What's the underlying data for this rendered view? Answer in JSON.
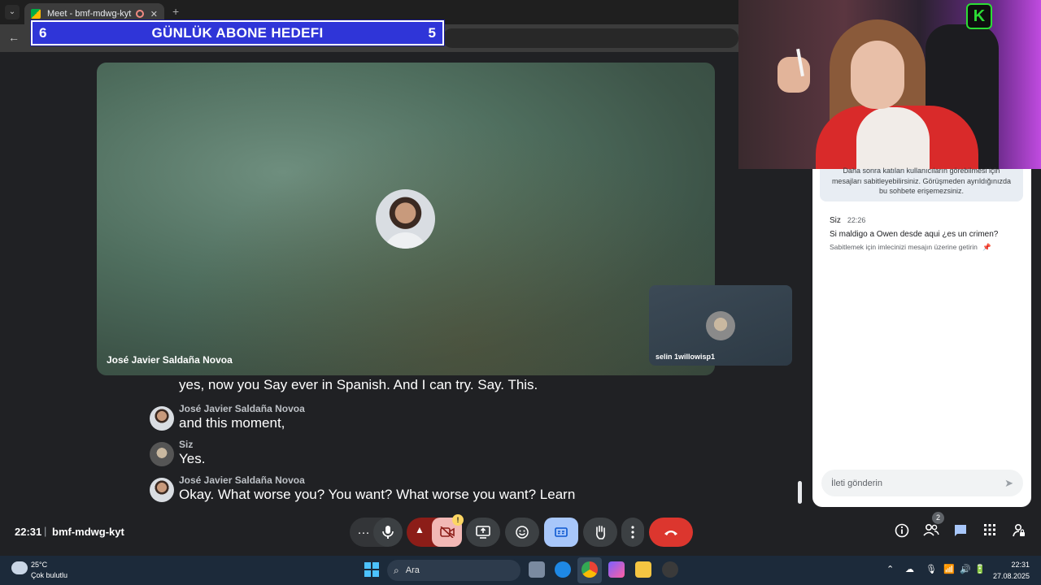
{
  "browser": {
    "tab_title": "Meet - bmf-mdwg-kyt",
    "tab_close": "✕",
    "new_tab": "+",
    "tab_search": "⌄",
    "back": "←"
  },
  "banner": {
    "left_number": "6",
    "title": "GÜNLÜK ABONE HEDEFI",
    "right_number": "5"
  },
  "meeting": {
    "main_participant": "José Javier Saldaña Novoa",
    "self_participant": "selin 1willowisp1",
    "time": "22:31",
    "separator": "|",
    "code": "bmf-mdwg-kyt"
  },
  "captions": {
    "first_line": "yes, now you Say ever in Spanish. And I can try. Say. This.",
    "entries": [
      {
        "speaker": "José Javier Saldaña Novoa",
        "text": "and this moment,"
      },
      {
        "speaker": "Siz",
        "text": "Yes."
      },
      {
        "speaker": "José Javier Saldaña Novoa",
        "text": "Okay. What worse you? You want? What worse you want? Learn"
      }
    ]
  },
  "chat": {
    "info_line1": "Daha sonra katılan kullanıcıların görebilmesi için",
    "info_line2": "mesajları sabitleyebilirsiniz. Görüşmeden ayrıldığınızda",
    "info_line3": "bu sohbete erişemezsiniz.",
    "message": {
      "sender": "Siz",
      "time": "22:26",
      "text": "Si maldigo a Owen desde aqui ¿es un crimen?",
      "hint": "Sabitlemek için imlecinizi mesajın üzerine getirin"
    },
    "input_placeholder": "İleti gönderin"
  },
  "controls": {
    "more_label": "···",
    "cam_warning_badge": "!",
    "people_count": "2"
  },
  "webcam": {
    "logo_letter": "K"
  },
  "taskbar": {
    "temperature": "25°C",
    "weather": "Çok bulutlu",
    "search_label": "Ara",
    "clock_time": "22:31",
    "clock_date": "27.08.2025"
  },
  "icons": {
    "mic": "mic-icon",
    "camera_off": "camera-off-icon",
    "present": "present-screen-icon",
    "emoji": "emoji-icon",
    "captions": "closed-captions-icon",
    "raise_hand": "raise-hand-icon",
    "leave": "end-call-icon",
    "info": "info-icon",
    "people": "people-icon",
    "chat": "chat-icon",
    "activities": "apps-grid-icon",
    "host_controls": "lock-person-icon"
  },
  "colors": {
    "banner_bg": "#2f35d8",
    "leave_red": "#dc362e",
    "cc_active": "#a8c7fa",
    "meet_bg": "#202124"
  }
}
